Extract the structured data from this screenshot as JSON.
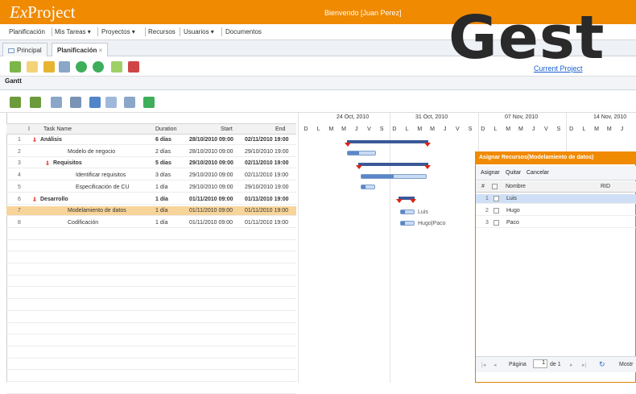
{
  "app": {
    "logo_prefix": "Ex",
    "logo_main": "Project",
    "welcome": "Bienvendo [Juan Perez]"
  },
  "menu": [
    "Planificación",
    "Mis Tareas ▾",
    "Proyectos ▾",
    "Recursos",
    "Usuarios ▾",
    "Documentos"
  ],
  "overlay_title": "Gest",
  "tabs": [
    {
      "label": "Principal"
    },
    {
      "label": "Planificación"
    }
  ],
  "current_project": "Current Project",
  "gantt_tab": "Gantt",
  "grid": {
    "columns": {
      "idx": "I",
      "task": "Task Name",
      "duration": "Duration",
      "start": "Start",
      "end": "End"
    },
    "rows": [
      {
        "n": "1",
        "task": "Análisis",
        "dur": "6 días",
        "start": "28/10/2010 09:00",
        "end": "02/11/2010 19:00",
        "bold": true
      },
      {
        "n": "2",
        "task": "Modelo de negocio",
        "dur": "2 días",
        "start": "28/10/2010 09:00",
        "end": "29/10/2010 19:00",
        "bold": false
      },
      {
        "n": "3",
        "task": "Requisitos",
        "dur": "5 días",
        "start": "29/10/2010 09:00",
        "end": "02/11/2010 19:00",
        "bold": true
      },
      {
        "n": "4",
        "task": "Identificar requisitos",
        "dur": "3 días",
        "start": "29/10/2010 09:00",
        "end": "02/11/2010 19:00",
        "bold": false
      },
      {
        "n": "5",
        "task": "Especificación de CU",
        "dur": "1 día",
        "start": "29/10/2010 09:00",
        "end": "29/10/2010 19:00",
        "bold": false
      },
      {
        "n": "6",
        "task": "Desarrollo",
        "dur": "1 día",
        "start": "01/11/2010 09:00",
        "end": "01/11/2010 19:00",
        "bold": true
      },
      {
        "n": "7",
        "task": "Modelamiento de datos",
        "dur": "1 día",
        "start": "01/11/2010 09:00",
        "end": "01/11/2010 19:00",
        "bold": false
      },
      {
        "n": "8",
        "task": "Codificación",
        "dur": "1 día",
        "start": "01/11/2010 09:00",
        "end": "01/11/2010 19:00",
        "bold": false
      }
    ]
  },
  "timeline": {
    "weeks": [
      "24 Oct, 2010",
      "31 Oct, 2010",
      "07 Nov, 2010",
      "14 Nov, 2010"
    ],
    "days": [
      "D",
      "L",
      "M",
      "M",
      "J",
      "V",
      "S",
      "D",
      "L",
      "M",
      "M",
      "J",
      "V",
      "S",
      "D",
      "L",
      "M",
      "M",
      "J",
      "V",
      "S",
      "D",
      "L",
      "M",
      "M",
      "J"
    ],
    "res_labels": [
      "Luis",
      "Hugo|Paco"
    ]
  },
  "dialog": {
    "title": "Asignar Recursos(Modelamiento de datos)",
    "tools": [
      "Asignar",
      "Quitar",
      "Cancelar"
    ],
    "col_num": "#",
    "col_name": "Nombre",
    "col_rid": "RID",
    "rows": [
      {
        "n": "1",
        "name": "Luis"
      },
      {
        "n": "2",
        "name": "Hugo"
      },
      {
        "n": "3",
        "name": "Paco"
      }
    ],
    "pager": {
      "page_label": "Página",
      "page_value": "1",
      "of": "de 1",
      "more": "Mostr"
    }
  }
}
